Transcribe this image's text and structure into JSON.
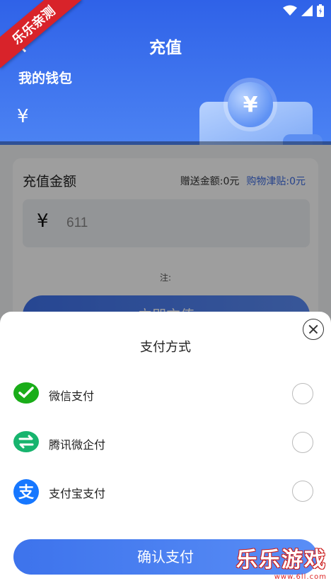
{
  "header": {
    "title": "充值",
    "wallet_label": "我的钱包",
    "balance_symbol": "¥",
    "coin_symbol": "¥",
    "ribbon_text": "乐乐亲测"
  },
  "recharge": {
    "title": "充值金额",
    "bonus_label": "赠送金额:0元",
    "subsidy_label": "购物津贴:0元",
    "currency_symbol": "¥",
    "amount_value": "611",
    "note": "注:",
    "button_label": "立即充值"
  },
  "payment_sheet": {
    "title": "支付方式",
    "methods": [
      {
        "label": "微信支付",
        "icon": "wechat-pay-icon",
        "color": "#1aad19"
      },
      {
        "label": "腾讯微企付",
        "icon": "tencent-qiye-pay-icon",
        "color": "#17b46e"
      },
      {
        "label": "支付宝支付",
        "icon": "alipay-icon",
        "color": "#1677ff"
      }
    ],
    "confirm_label": "确认支付"
  },
  "watermark": {
    "big": "乐乐游戏",
    "small": "www.6ll.com"
  },
  "colors": {
    "primary": "#3f72ec",
    "header_top": "#2f62e8",
    "subsidy_text": "#3c6be0"
  }
}
